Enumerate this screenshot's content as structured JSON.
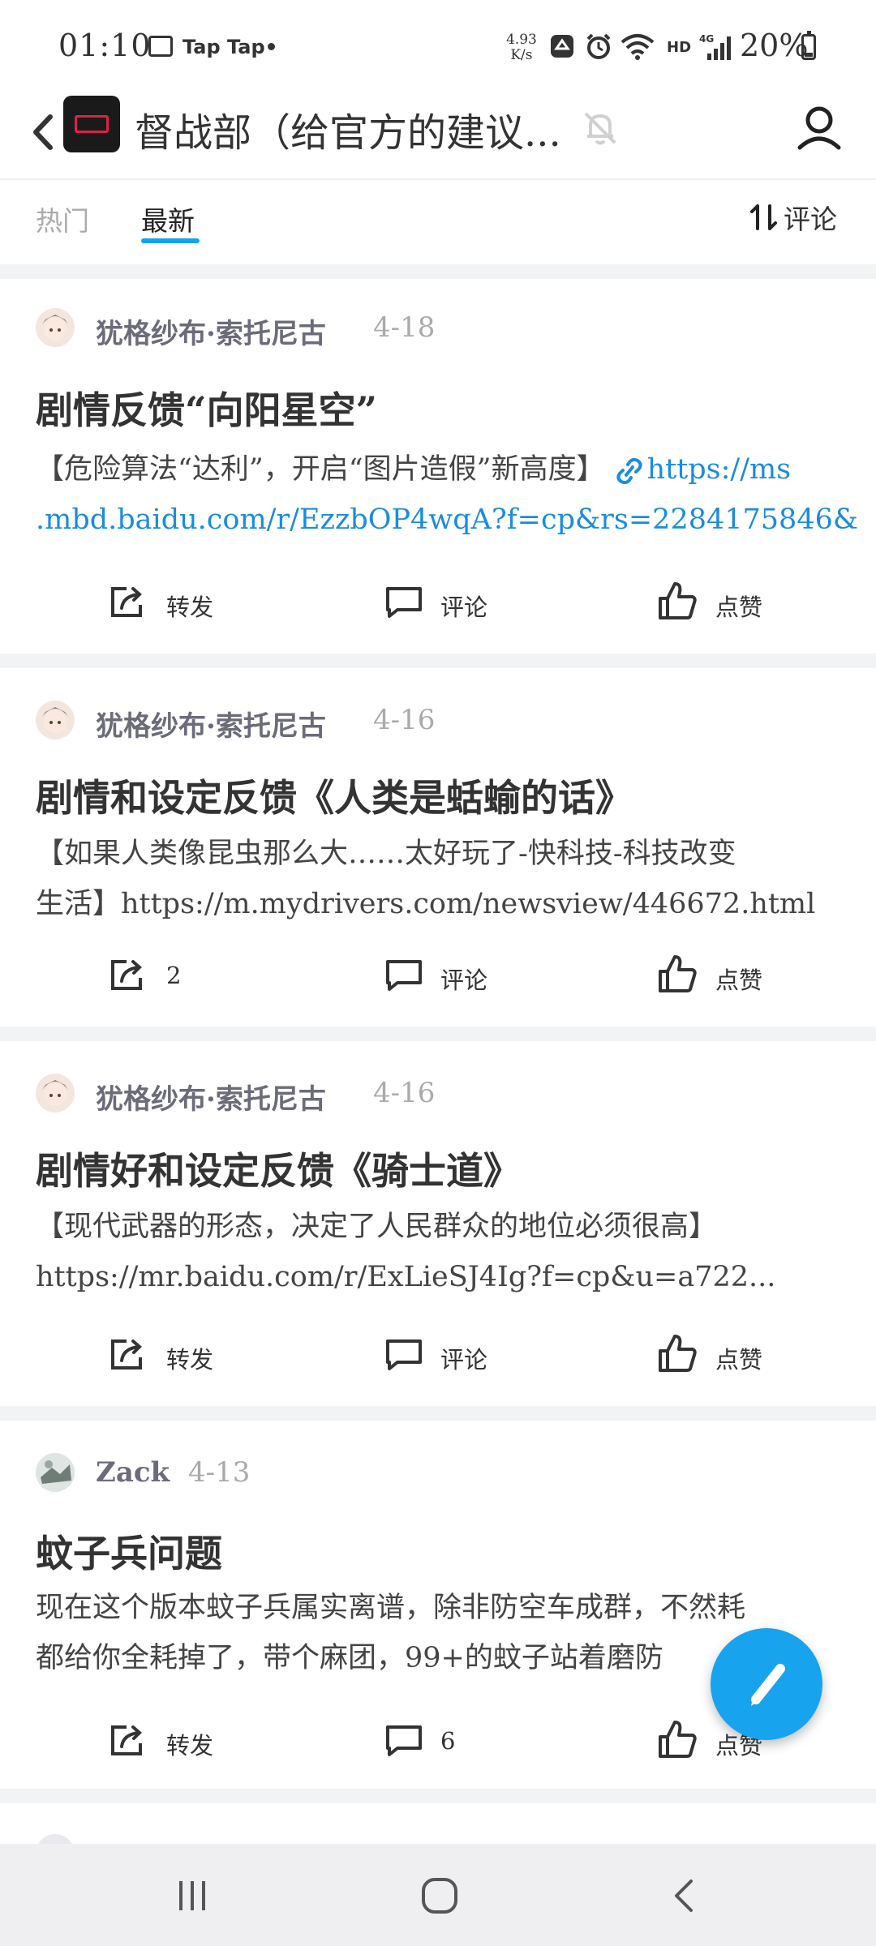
{
  "status_bar": {
    "time": "01:10",
    "app1": "Tap",
    "app2": "Tap",
    "net_speed_value": "4.93",
    "net_speed_unit": "K/s",
    "hd": "HD",
    "battery": "20%"
  },
  "header": {
    "title": "督战部（给官方的建议..."
  },
  "tabs": {
    "hot": "热门",
    "latest": "最新",
    "sort": "评论"
  },
  "posts": [
    {
      "author": "犹格纱布·索托尼古",
      "date": "4-18",
      "title": "剧情反馈“向阳星空”",
      "body_line1": "【危险算法“达利”，开启“图片造假”新高度】",
      "link1": "https://ms",
      "body_line2": ".mbd.baidu.com/r/EzzbOP4wqA?f=cp&rs=2284175846&",
      "share": "转发",
      "comment": "评论",
      "like": "点赞"
    },
    {
      "author": "犹格纱布·索托尼古",
      "date": "4-16",
      "title": "剧情和设定反馈《人类是蛞蝓的话》",
      "body_line1": "【如果人类像昆虫那么大……太好玩了-快科技-科技改变",
      "body_line2": "生活】https://m.mydrivers.com/newsview/446672.html",
      "share": "2",
      "comment": "评论",
      "like": "点赞"
    },
    {
      "author": "犹格纱布·索托尼古",
      "date": "4-16",
      "title": "剧情好和设定反馈《骑士道》",
      "body_line1": "【现代武器的形态，决定了人民群众的地位必须很高】",
      "body_line2": "https://mr.baidu.com/r/ExLieSJ4Ig?f=cp&u=a722...",
      "share": "转发",
      "comment": "评论",
      "like": "点赞"
    },
    {
      "author": "Zack",
      "date": "4-13",
      "title": "蚊子兵问题",
      "body_line1": "现在这个版本蚊子兵属实离谱，除非防空车成群，不然耗",
      "body_line2": "都给你全耗掉了，带个麻团，99+的蚊子站着磨防",
      "share": "转发",
      "comment": "6",
      "like": "点赞"
    }
  ],
  "colors": {
    "accent": "#14a3ee",
    "link": "#1a8ce0",
    "fab": "#18a3ef"
  }
}
